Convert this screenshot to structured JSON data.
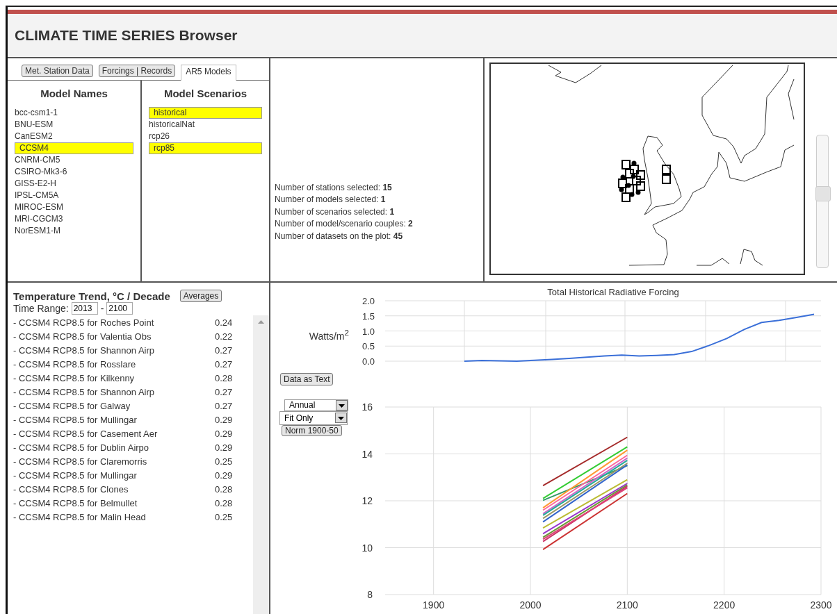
{
  "header": {
    "title": "CLIMATE TIME SERIES Browser"
  },
  "tabs": [
    {
      "label": "Met. Station Data",
      "selected": false
    },
    {
      "label": "Forcings | Records",
      "selected": false
    },
    {
      "label": "AR5 Models",
      "selected": true
    }
  ],
  "model_names": {
    "heading": "Model Names",
    "items": [
      {
        "label": "bcc-csm1-1",
        "selected": false
      },
      {
        "label": "BNU-ESM",
        "selected": false
      },
      {
        "label": "CanESM2",
        "selected": false
      },
      {
        "label": "CCSM4",
        "selected": true
      },
      {
        "label": "CNRM-CM5",
        "selected": false
      },
      {
        "label": "CSIRO-Mk3-6",
        "selected": false
      },
      {
        "label": "GISS-E2-H",
        "selected": false
      },
      {
        "label": "IPSL-CM5A",
        "selected": false
      },
      {
        "label": "MIROC-ESM",
        "selected": false
      },
      {
        "label": "MRI-CGCM3",
        "selected": false
      },
      {
        "label": "NorESM1-M",
        "selected": false
      }
    ]
  },
  "model_scenarios": {
    "heading": "Model Scenarios",
    "items": [
      {
        "label": "historical",
        "selected": true
      },
      {
        "label": "historicalNat",
        "selected": false
      },
      {
        "label": "rcp26",
        "selected": false
      },
      {
        "label": "rcp85",
        "selected": true
      }
    ]
  },
  "stats": [
    "Number of stations selected: **15**",
    "Number of models selected: **1**",
    "Number of scenarios selected: **1**",
    "Number of model/scenario couples: **2**",
    "Number of datasets on the plot: **45**"
  ],
  "map": {
    "zoom_slider": {
      "level": 0.57
    }
  },
  "trend": {
    "title": "Temperature Trend, °C / Decade",
    "averages_button": "Averages",
    "time_range": {
      "label": "Time Range:",
      "from": "2013",
      "separator": "-",
      "to": "2100"
    },
    "rows": [
      {
        "label": "- CCSM4 RCP8.5 for Roches Point",
        "value": "0.24"
      },
      {
        "label": "- CCSM4 RCP8.5 for Valentia Obs",
        "value": "0.22"
      },
      {
        "label": "- CCSM4 RCP8.5 for Shannon Airp",
        "value": "0.27"
      },
      {
        "label": "- CCSM4 RCP8.5 for Rosslare",
        "value": "0.27"
      },
      {
        "label": "- CCSM4 RCP8.5 for Kilkenny",
        "value": "0.28"
      },
      {
        "label": "- CCSM4 RCP8.5 for Shannon Airp",
        "value": "0.27"
      },
      {
        "label": "- CCSM4 RCP8.5 for Galway",
        "value": "0.27"
      },
      {
        "label": "- CCSM4 RCP8.5 for Mullingar",
        "value": "0.29"
      },
      {
        "label": "- CCSM4 RCP8.5 for Casement Aer",
        "value": "0.29"
      },
      {
        "label": "- CCSM4 RCP8.5 for Dublin Airpo",
        "value": "0.29"
      },
      {
        "label": "- CCSM4 RCP8.5 for Claremorris",
        "value": "0.25"
      },
      {
        "label": "- CCSM4 RCP8.5 for Mullingar",
        "value": "0.29"
      },
      {
        "label": "- CCSM4 RCP8.5 for Clones",
        "value": "0.28"
      },
      {
        "label": "- CCSM4 RCP8.5 for Belmullet",
        "value": "0.28"
      },
      {
        "label": "- CCSM4 RCP8.5 for Malin Head",
        "value": "0.25"
      }
    ]
  },
  "controls": {
    "data_button": "Data as Text",
    "period_select": "Annual",
    "fit_select": "Fit Only",
    "norm_button": "Norm 1900-50"
  },
  "forcing_chart": {
    "chart_data": {
      "type": "line",
      "grid": true,
      "title": "Total Historical Radiative Forcing",
      "ylabel": "Watts/m$^{2}$",
      "ylim": [
        0,
        2
      ],
      "yticks": [
        {
          "value": 0,
          "label": "0.0"
        },
        {
          "value": 0.5,
          "label": "0.5"
        },
        {
          "value": 1,
          "label": "1.0"
        },
        {
          "value": 1.5,
          "label": "1.5"
        },
        {
          "value": 2,
          "label": "2.0"
        }
      ],
      "series": [
        {
          "color": "#3a6fd8",
          "values": [
            0,
            0.02,
            0.01,
            0,
            0.03,
            0.06,
            0.09,
            0.13,
            0.17,
            0.2,
            0.17,
            0.19,
            0.22,
            0.32,
            0.52,
            0.75,
            1.05,
            1.28,
            1.35,
            1.45,
            1.55
          ]
        }
      ]
    }
  },
  "temperature_chart": {
    "chart_data": {
      "type": "line",
      "grid": true,
      "x": [
        2013,
        2100
      ],
      "xlim": [
        1850,
        2300
      ],
      "ylim": [
        8,
        16
      ],
      "xticks": [
        1900,
        2000,
        2100,
        2200,
        2300
      ],
      "yticks": [
        8,
        10,
        12,
        14,
        16
      ],
      "series": [
        {
          "color": "#a52a2a",
          "values": [
            12.65,
            14.71
          ]
        },
        {
          "color": "#33cc33",
          "values": [
            12.1,
            14.3
          ]
        },
        {
          "color": "#339966",
          "values": [
            12.02,
            13.5
          ]
        },
        {
          "color": "#ff9933",
          "values": [
            11.7,
            14.16
          ]
        },
        {
          "color": "#ff6699",
          "values": [
            11.6,
            13.94
          ]
        },
        {
          "color": "#cc66cc",
          "values": [
            11.45,
            13.82
          ]
        },
        {
          "color": "#999966",
          "values": [
            11.25,
            13.6
          ]
        },
        {
          "color": "#3366cc",
          "values": [
            11.1,
            13.53
          ]
        },
        {
          "color": "#bbbb33",
          "values": [
            10.84,
            12.9
          ]
        },
        {
          "color": "#9933cc",
          "values": [
            10.6,
            12.74
          ]
        },
        {
          "color": "#669933",
          "values": [
            10.44,
            12.68
          ]
        },
        {
          "color": "#cc3366",
          "values": [
            10.26,
            12.62
          ]
        },
        {
          "color": "#cc3333",
          "values": [
            9.92,
            12.31
          ]
        },
        {
          "color": "#dd4477",
          "values": [
            10.36,
            12.55
          ]
        },
        {
          "color": "#22aa99",
          "values": [
            11.38,
            13.72
          ]
        }
      ]
    }
  }
}
